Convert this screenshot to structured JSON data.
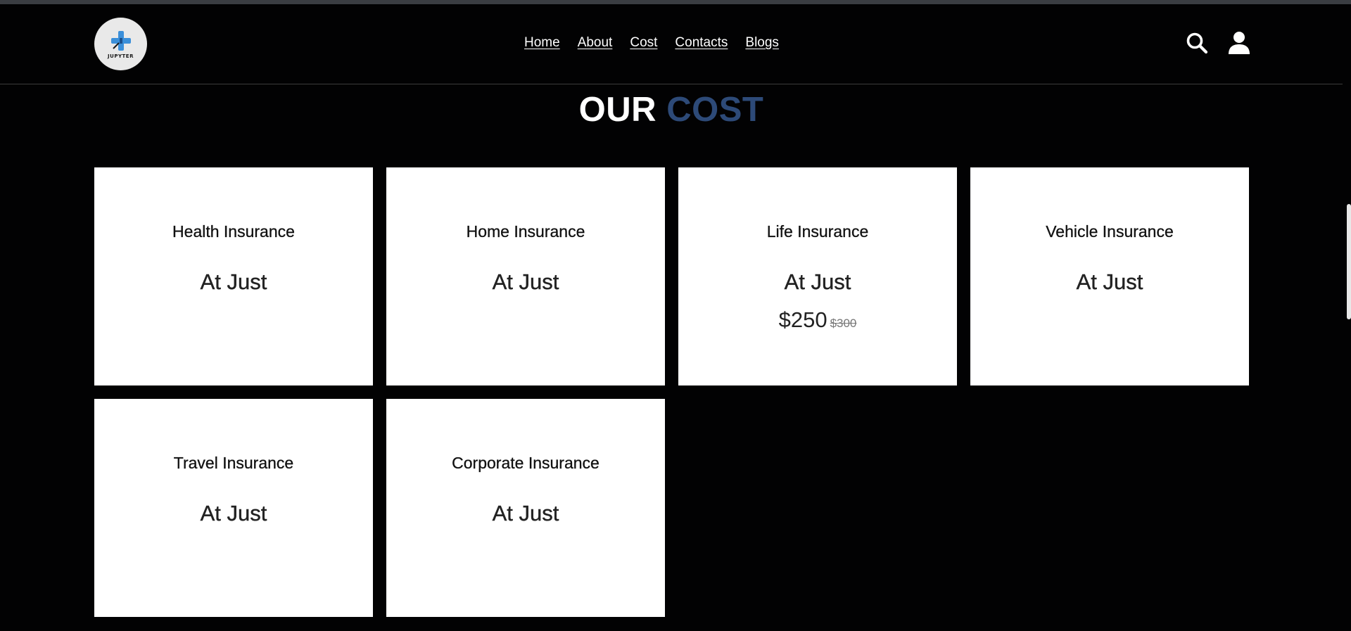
{
  "colors": {
    "background": "#020203",
    "accent": "#2d4a78",
    "card": "#ffffff",
    "text_dark": "#111111"
  },
  "header": {
    "logo_text": "JUPYTER",
    "nav": [
      {
        "label": "Home"
      },
      {
        "label": "About"
      },
      {
        "label": "Cost"
      },
      {
        "label": "Contacts"
      },
      {
        "label": "Blogs"
      }
    ],
    "icons": [
      "search-icon",
      "user-icon"
    ]
  },
  "section": {
    "title_part1": "OUR",
    "title_part2": "COST"
  },
  "cards": [
    {
      "title": "Health Insurance",
      "subtitle": "At Just"
    },
    {
      "title": "Home Insurance",
      "subtitle": "At Just"
    },
    {
      "title": "Life Insurance",
      "subtitle": "At Just",
      "price": "$250",
      "old_price": "$300"
    },
    {
      "title": "Vehicle Insurance",
      "subtitle": "At Just"
    },
    {
      "title": "Travel Insurance",
      "subtitle": "At Just"
    },
    {
      "title": "Corporate Insurance",
      "subtitle": "At Just"
    }
  ]
}
